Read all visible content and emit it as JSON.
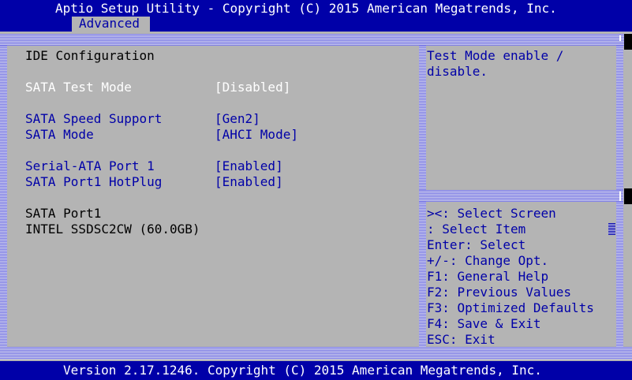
{
  "header": {
    "title": "Aptio Setup Utility - Copyright (C) 2015 American Megatrends, Inc.",
    "tab": "Advanced"
  },
  "main": {
    "section_title": "IDE Configuration",
    "settings": [
      {
        "label": "SATA Test Mode",
        "value": "[Disabled]"
      },
      {
        "label": "SATA Speed Support",
        "value": "[Gen2]"
      },
      {
        "label": "SATA Mode",
        "value": "[AHCI Mode]"
      },
      {
        "label": "Serial-ATA Port 1",
        "value": "[Enabled]"
      },
      {
        "label": "SATA Port1 HotPlug",
        "value": "[Enabled]"
      }
    ],
    "port_label": "SATA Port1",
    "port_device": "INTEL SSDSC2CW (60.0GB)"
  },
  "help": {
    "line1": "Test Mode enable /",
    "line2": "disable."
  },
  "keys": [
    "><: Select Screen",
    ": Select Item",
    "Enter: Select",
    "+/-: Change Opt.",
    "F1: General Help",
    "F2: Previous Values",
    "F3: Optimized Defaults",
    "F4: Save & Exit",
    "ESC: Exit"
  ],
  "footer": "Version 2.17.1246. Copyright (C) 2015 American Megatrends, Inc.",
  "colors": {
    "background": "#0000a8",
    "panel": "#b4b4b4",
    "selected_text": "#ffffff",
    "item_text": "#0000a8",
    "static_text": "#000000"
  }
}
